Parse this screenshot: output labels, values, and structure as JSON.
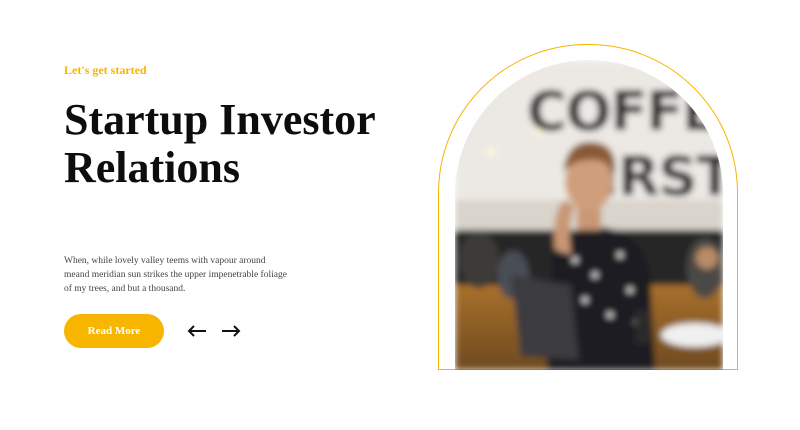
{
  "hero": {
    "eyebrow": "Let's get started",
    "title_line1": "Startup Investor",
    "title_line2": "Relations",
    "description": "When, while lovely valley teems with vapour around meand meridian sun strikes the upper impenetrable foliage of my trees, and but a thousand.",
    "read_more_label": "Read More",
    "prev_icon": "arrow-left-icon",
    "next_icon": "arrow-right-icon"
  },
  "photo": {
    "wall_sign": "COFFEE FIRST",
    "description": "",
    "frame": "arch"
  },
  "colors": {
    "accent": "#f7b500",
    "heading": "#0d0d0d",
    "body_text": "#444444",
    "background": "#ffffff"
  }
}
